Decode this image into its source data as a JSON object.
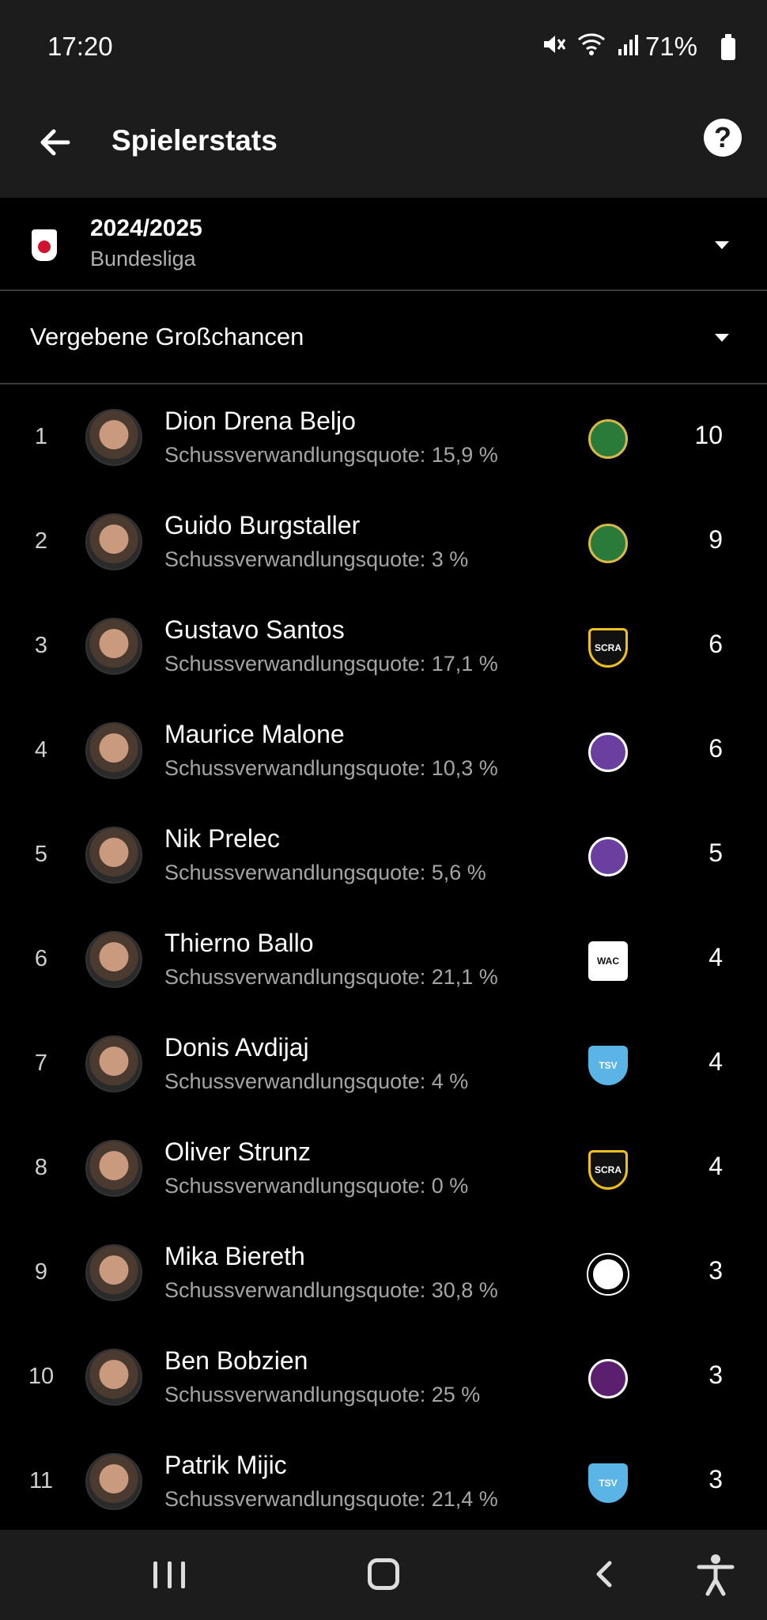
{
  "status_bar": {
    "time": "17:20",
    "battery": "71%"
  },
  "app_bar": {
    "title": "Spielerstats",
    "help_label": "?"
  },
  "season_selector": {
    "season": "2024/2025",
    "league": "Bundesliga"
  },
  "category_selector": {
    "label": "Vergebene Großchancen"
  },
  "players": [
    {
      "rank": "1",
      "name": "Dion Drena Beljo",
      "quote": "Schussverwandlungsquote: 15,9 %",
      "club": "rapid",
      "value": "10"
    },
    {
      "rank": "2",
      "name": "Guido Burgstaller",
      "quote": "Schussverwandlungsquote: 3 %",
      "club": "rapid",
      "value": "9"
    },
    {
      "rank": "3",
      "name": "Gustavo Santos",
      "quote": "Schussverwandlungsquote: 17,1 %",
      "club": "scra",
      "value": "6"
    },
    {
      "rank": "4",
      "name": "Maurice Malone",
      "quote": "Schussverwandlungsquote: 10,3 %",
      "club": "austria-wien",
      "value": "6"
    },
    {
      "rank": "5",
      "name": "Nik Prelec",
      "quote": "Schussverwandlungsquote: 5,6 %",
      "club": "austria-wien",
      "value": "5"
    },
    {
      "rank": "6",
      "name": "Thierno Ballo",
      "quote": "Schussverwandlungsquote: 21,1 %",
      "club": "wac",
      "value": "4"
    },
    {
      "rank": "7",
      "name": "Donis Avdijaj",
      "quote": "Schussverwandlungsquote: 4 %",
      "club": "hartberg",
      "value": "4"
    },
    {
      "rank": "8",
      "name": "Oliver Strunz",
      "quote": "Schussverwandlungsquote: 0 %",
      "club": "scra",
      "value": "4"
    },
    {
      "rank": "9",
      "name": "Mika Biereth",
      "quote": "Schussverwandlungsquote: 30,8 %",
      "club": "sturm",
      "value": "3"
    },
    {
      "rank": "10",
      "name": "Ben Bobzien",
      "quote": "Schussverwandlungsquote: 25 %",
      "club": "austria-lustenau",
      "value": "3"
    },
    {
      "rank": "11",
      "name": "Patrik Mijic",
      "quote": "Schussverwandlungsquote: 21,4 %",
      "club": "hartberg",
      "value": "3"
    }
  ],
  "club_logo_text": {
    "scra": "SCRA",
    "wac": "WAC",
    "hartberg": "TSV"
  },
  "colors": {
    "background": "#000000",
    "bar": "#1c1c1c",
    "divider": "#3a3a3a",
    "subtext": "#a5a5a5",
    "rapid_green": "#2a7a3a",
    "austria_violet": "#6b3fa0",
    "hartberg_blue": "#5ab4e6"
  }
}
